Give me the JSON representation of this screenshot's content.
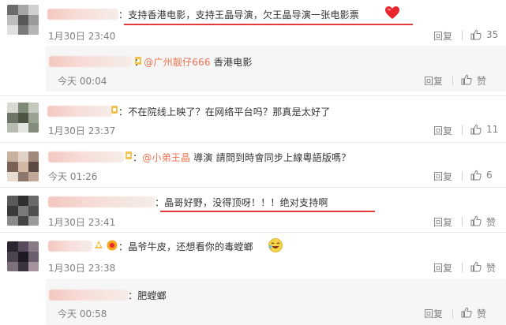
{
  "comments": [
    {
      "text": "：支持香港电影，支持王晶导演，欠王晶导演一张电影票",
      "time": "1月30日 23:40",
      "reply_label": "回复",
      "like_count": "35"
    },
    {
      "mention": "@广州靓仔666",
      "text": " 香港电影",
      "time": "今天 00:04",
      "reply_label": "回复",
      "like_label": "赞"
    },
    {
      "text": "：不在院线上映了？在网络平台吗？那真是太好了",
      "time": "1月30日 23:37",
      "reply_label": "回复",
      "like_count": "11"
    },
    {
      "prefix": "：",
      "mention": "@小弟王晶",
      "text": " 導演 請問到時會同步上線粵語版嗎？",
      "time": "今天 01:26",
      "reply_label": "回复",
      "like_count": "6"
    },
    {
      "text": "：晶哥好野，没得顶呀！！！绝对支持啊",
      "time": "1月30日 23:41",
      "reply_label": "回复",
      "like_label": "赞"
    },
    {
      "text": "：晶爷牛皮，还想看你的毒螳螂",
      "time": "1月30日 23:38",
      "reply_label": "回复",
      "like_label": "赞"
    },
    {
      "text": "：肥螳螂",
      "time": "今天 00:58",
      "reply_label": "回复",
      "like_label": "赞"
    }
  ],
  "colors": {
    "mention": "#eb7350",
    "underline": "#e4393c",
    "meta": "#808080",
    "reply_bg": "#f6f6f6"
  },
  "icons": {
    "like": "thumbs-up-icon",
    "heart": "red-heart-emoji",
    "laugh": "laughing-face-emoji",
    "badge": "user-badge-icon"
  }
}
